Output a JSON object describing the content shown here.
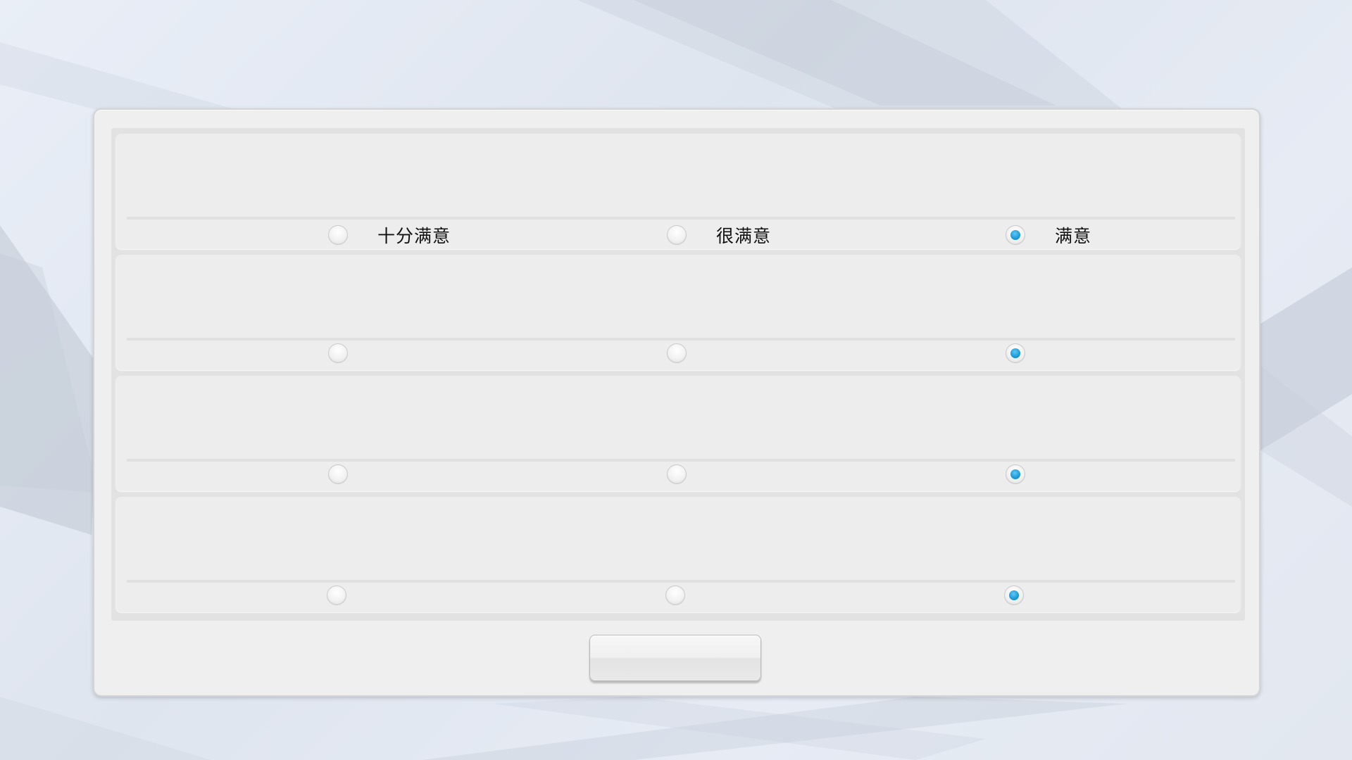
{
  "survey": {
    "options": [
      "十分满意",
      "很满意",
      "满意"
    ],
    "questions": [
      {
        "title": "",
        "selected_index": 2,
        "show_labels": true
      },
      {
        "title": "",
        "selected_index": 2,
        "show_labels": false
      },
      {
        "title": "",
        "selected_index": 2,
        "show_labels": false
      },
      {
        "title": "",
        "selected_index": 2,
        "show_labels": false
      }
    ],
    "submit_label": ""
  },
  "colors": {
    "radio_selected": "#1a9ad9",
    "panel_background": "#efefef",
    "question_background": "#ededed"
  }
}
